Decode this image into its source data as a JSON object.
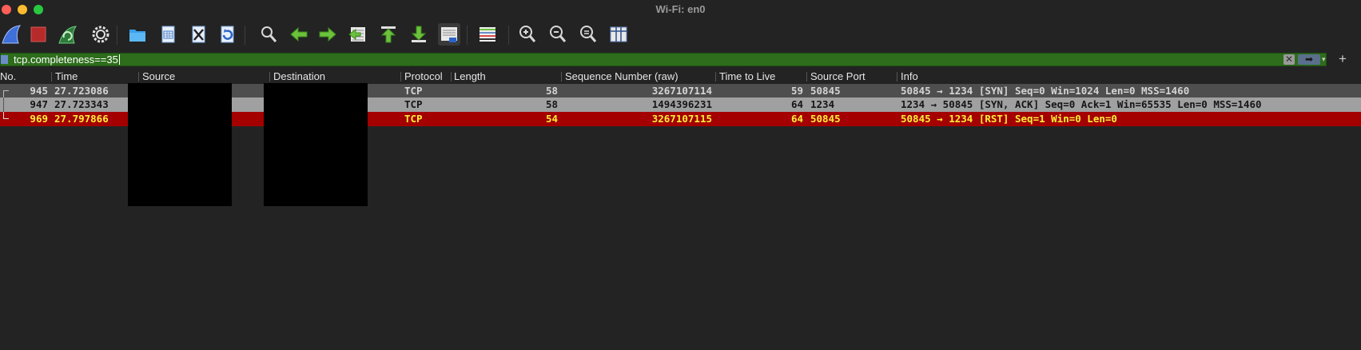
{
  "window": {
    "title": "Wi-Fi: en0"
  },
  "toolbar": {
    "buttons": [
      {
        "id": "start-capture",
        "icon": "shark-fin-icon"
      },
      {
        "id": "stop-capture",
        "icon": "stop-square-icon"
      },
      {
        "id": "restart-capture",
        "icon": "restart-fin-icon"
      },
      {
        "id": "capture-options",
        "icon": "gear-icon"
      },
      {
        "id": "open-file",
        "icon": "folder-icon"
      },
      {
        "id": "save-file",
        "icon": "file-icon"
      },
      {
        "id": "close-file",
        "icon": "close-file-icon"
      },
      {
        "id": "reload-file",
        "icon": "reload-icon"
      },
      {
        "id": "find-packet",
        "icon": "magnifier-icon"
      },
      {
        "id": "go-back",
        "icon": "arrow-left-icon"
      },
      {
        "id": "go-forward",
        "icon": "arrow-right-icon"
      },
      {
        "id": "go-to-packet",
        "icon": "goto-packet-icon"
      },
      {
        "id": "first-packet",
        "icon": "first-packet-icon"
      },
      {
        "id": "last-packet",
        "icon": "last-packet-icon"
      },
      {
        "id": "auto-scroll",
        "icon": "auto-scroll-icon"
      },
      {
        "id": "colorize",
        "icon": "colorize-icon"
      },
      {
        "id": "zoom-in",
        "icon": "zoom-in-icon"
      },
      {
        "id": "zoom-out",
        "icon": "zoom-out-icon"
      },
      {
        "id": "normal-size",
        "icon": "zoom-reset-icon"
      },
      {
        "id": "resize-columns",
        "icon": "resize-columns-icon"
      }
    ]
  },
  "filter": {
    "value": "tcp.completeness==35",
    "clear_glyph": "✕",
    "apply_glyph": "➡",
    "dropdown_glyph": "▾",
    "add_glyph": "+"
  },
  "columns": [
    "No.",
    "Time",
    "Source",
    "Destination",
    "Protocol",
    "Length",
    "Sequence Number (raw)",
    "Time to Live",
    "Source Port",
    "Info"
  ],
  "packets": [
    {
      "no": "945",
      "time": "27.723086",
      "protocol": "TCP",
      "length": "58",
      "seq_raw": "3267107114",
      "ttl": "59",
      "src_port": "50845",
      "info": "50845 → 1234 [SYN] Seq=0 Win=1024 Len=0 MSS=1460"
    },
    {
      "no": "947",
      "time": "27.723343",
      "protocol": "TCP",
      "length": "58",
      "seq_raw": "1494396231",
      "ttl": "64",
      "src_port": "1234",
      "info": "1234 → 50845 [SYN, ACK] Seq=0 Ack=1 Win=65535 Len=0 MSS=1460"
    },
    {
      "no": "969",
      "time": "27.797866",
      "protocol": "TCP",
      "length": "54",
      "seq_raw": "3267107115",
      "ttl": "64",
      "src_port": "50845",
      "info": "50845 → 1234 [RST] Seq=1 Win=0 Len=0"
    }
  ],
  "colors": {
    "background": "#232323",
    "filter_valid": "#2d6d1b",
    "row_syn": "#4e4e4e",
    "row_selected": "#a0a0a0",
    "row_rst": "#a40000",
    "rst_text": "#ffef3a"
  }
}
